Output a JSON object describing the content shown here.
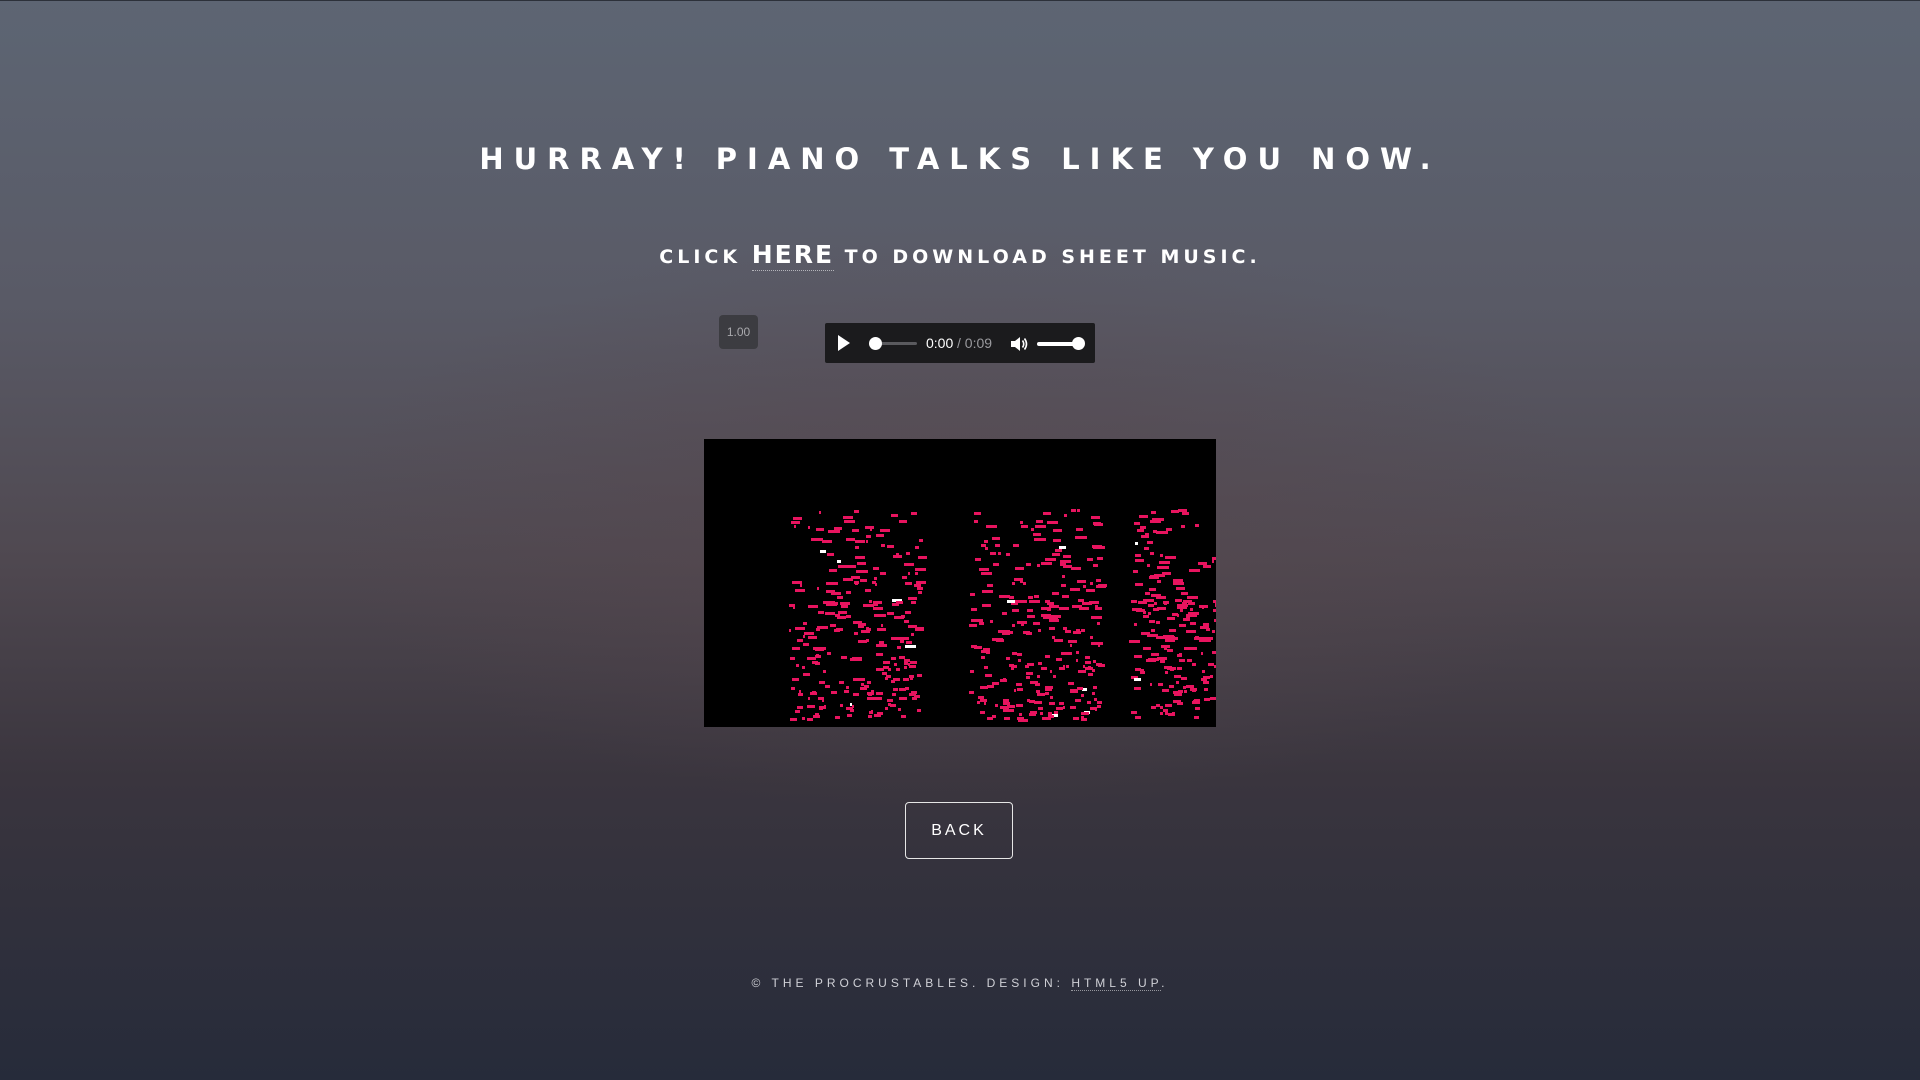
{
  "headline": "HURRAY! PIANO TALKS LIKE YOU NOW.",
  "download": {
    "prefix": "CLICK ",
    "link_label": "HERE",
    "suffix": " TO DOWNLOAD SHEET MUSIC."
  },
  "speed_badge": "1.00",
  "audio_player": {
    "current_time": "0:00",
    "duration_text": "/ 0:09",
    "progress": 0.0,
    "volume": 1.0
  },
  "piano_roll": {
    "background_color": "#000000",
    "note_color": "#e8145f",
    "highlight_color": "#ffffff"
  },
  "back_button": "BACK",
  "footer": {
    "prefix": "© THE PROCRUSTABLES. DESIGN: ",
    "link_label": "HTML5 UP",
    "suffix": "."
  }
}
